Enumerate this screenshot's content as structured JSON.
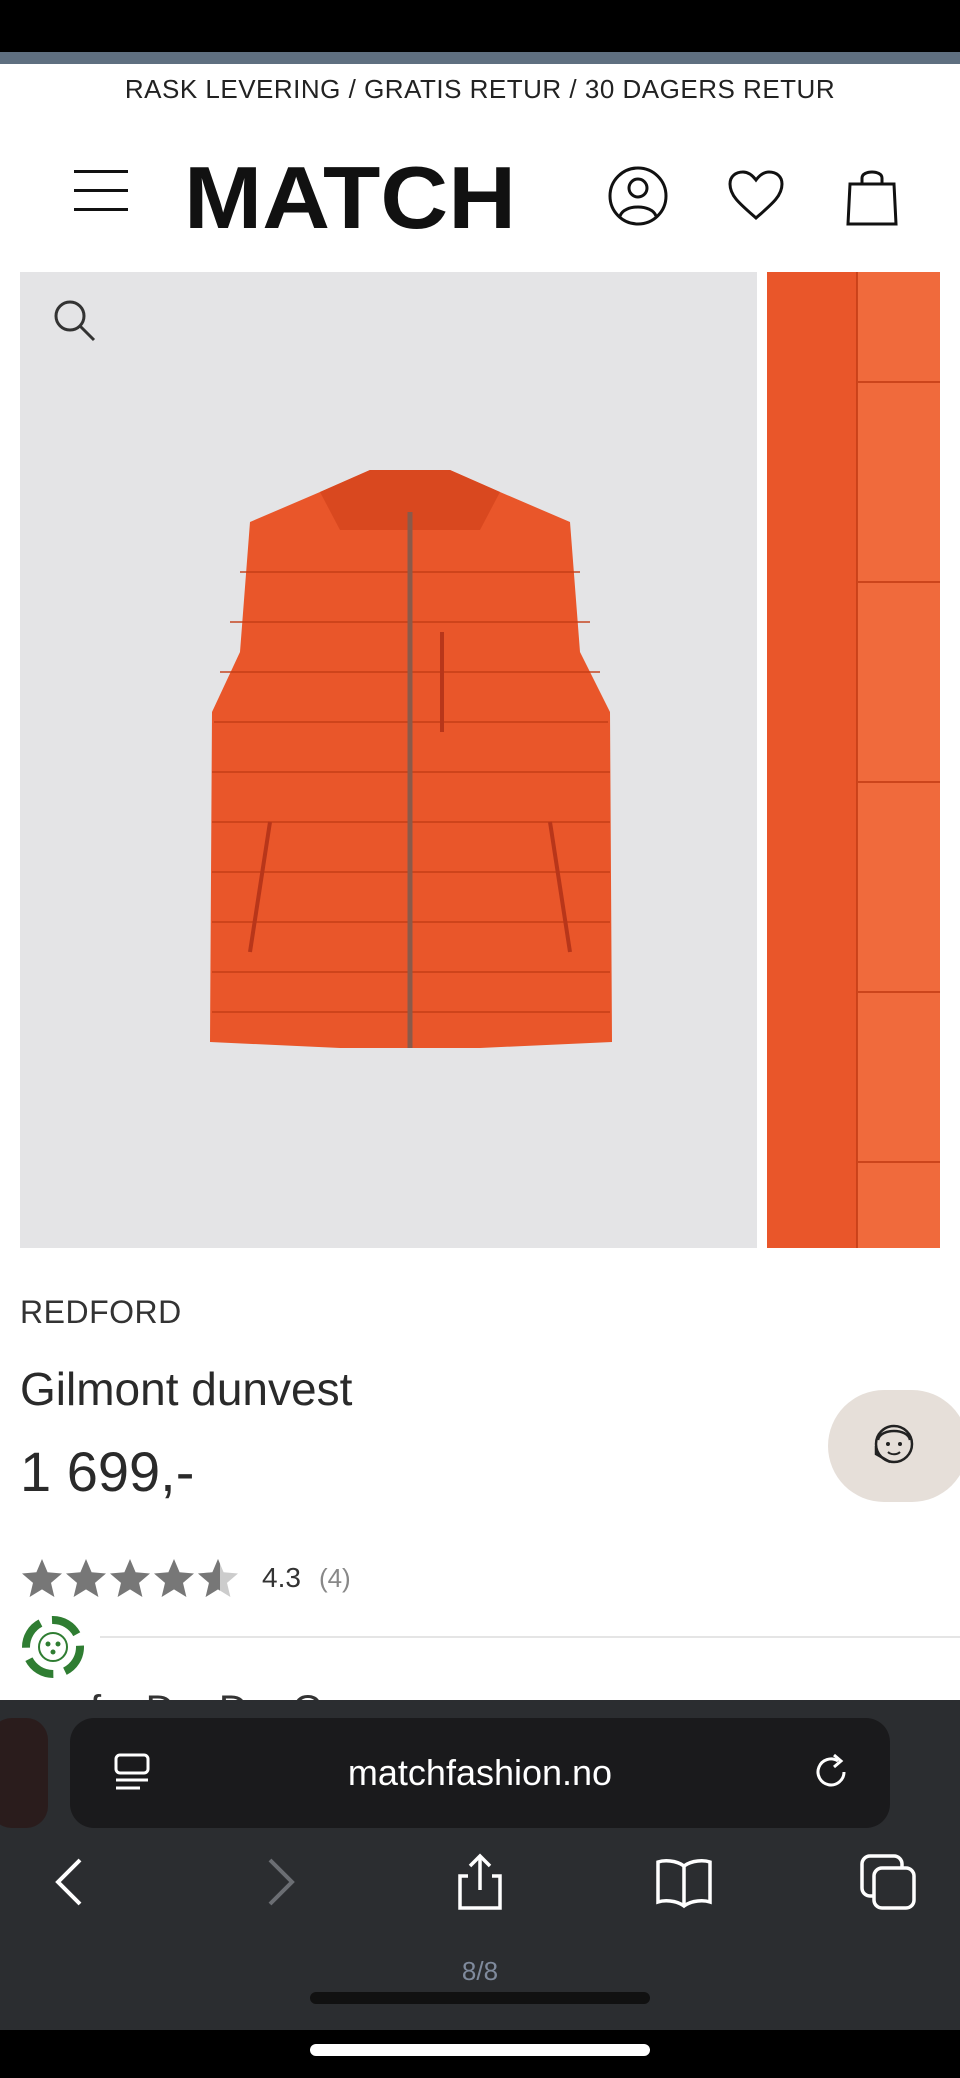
{
  "promo_banner": "RASK LEVERING / GRATIS RETUR / 30 DAGERS RETUR",
  "header": {
    "logo_text": "MATCH",
    "icons": [
      "menu-icon",
      "account-icon",
      "heart-icon",
      "cart-icon"
    ]
  },
  "product": {
    "brand": "REDFORD",
    "name": "Gilmont dunvest",
    "price": "1 699,-",
    "rating": {
      "value": "4.3",
      "count": "(4)",
      "stars_filled": 4.3,
      "stars_max": 5
    },
    "image_color": "#e9562a",
    "cut_off_text": "f... D... D... O..."
  },
  "browser": {
    "url": "matchfashion.no",
    "page_count": "8/8",
    "toolbar": [
      "back-icon",
      "forward-icon",
      "share-icon",
      "bookmarks-icon",
      "tabs-icon"
    ]
  },
  "colors": {
    "accent_orange": "#e9562a",
    "toolbar_bg": "#2b2d30",
    "chat_bg": "#e6dfd9"
  }
}
